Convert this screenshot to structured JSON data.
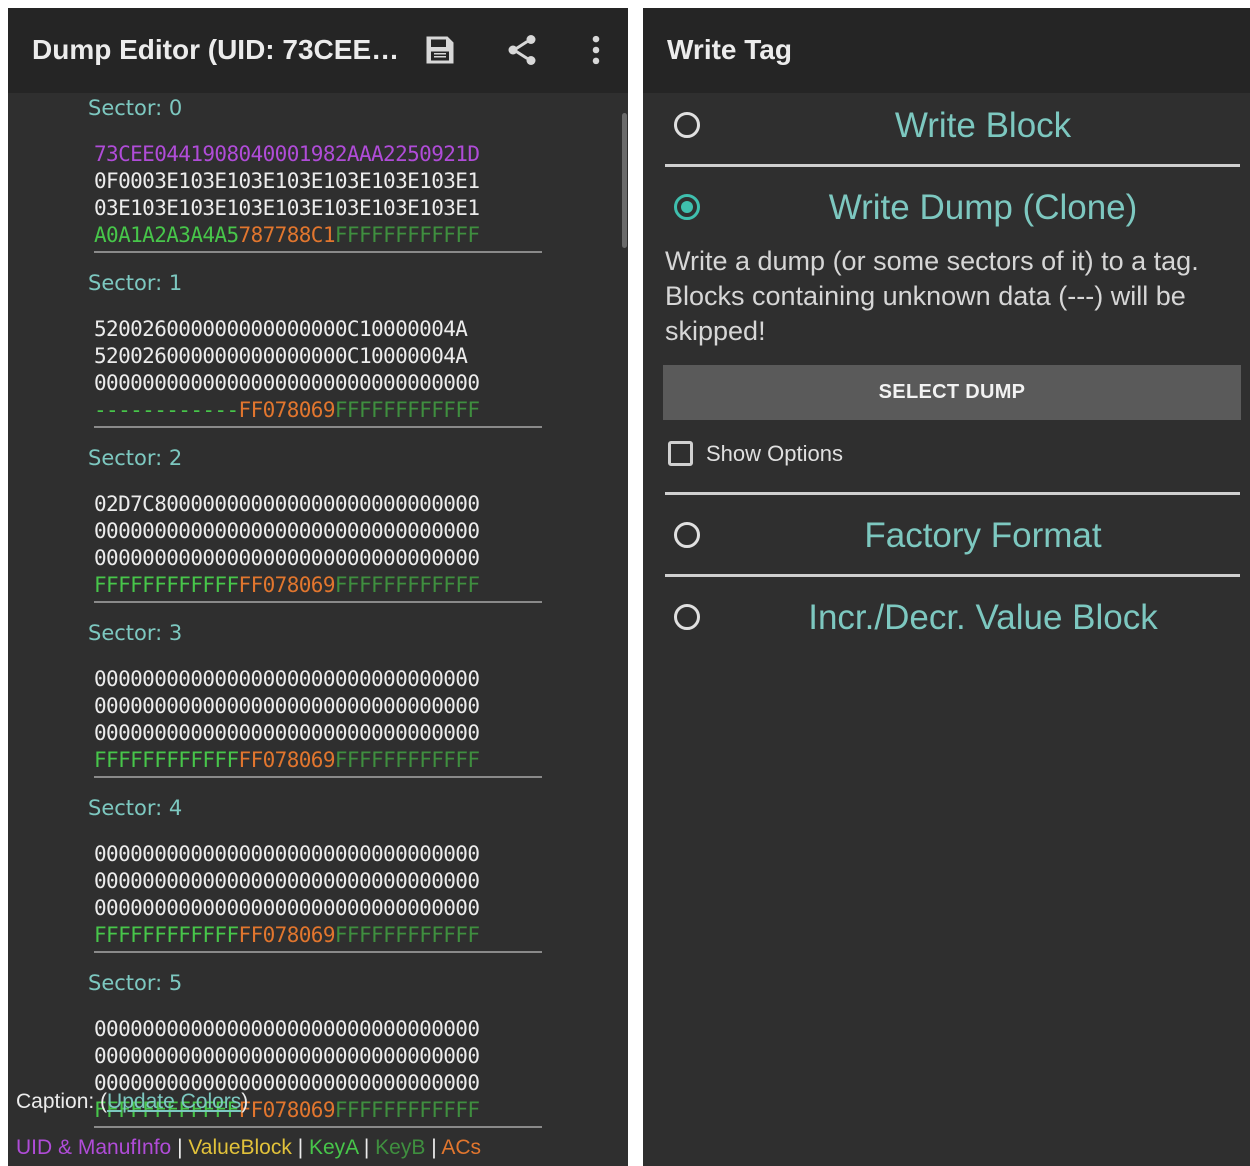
{
  "left_app": {
    "title": "Dump Editor (UID: 73CEE…",
    "icons": [
      "save-icon",
      "share-icon",
      "overflow-menu-icon"
    ],
    "sectors": [
      {
        "label": "Sector: 0",
        "lines": [
          [
            {
              "t": "73CEE0441908040001982AAA2250921D",
              "c": "uid"
            }
          ],
          [
            {
              "t": "0F0003E103E103E103E103E103E103E1",
              "c": "plain"
            }
          ],
          [
            {
              "t": "03E103E103E103E103E103E103E103E1",
              "c": "plain"
            }
          ],
          [
            {
              "t": "A0A1A2A3A4A5",
              "c": "key"
            },
            {
              "t": "787788C1",
              "c": "ac"
            },
            {
              "t": "FFFFFFFFFFFF",
              "c": "keyb"
            }
          ]
        ]
      },
      {
        "label": "Sector: 1",
        "lines": [
          [
            {
              "t": "520026000000000000000C10000004A",
              "c": "plain"
            }
          ],
          [
            {
              "t": "520026000000000000000C10000004A",
              "c": "plain"
            }
          ],
          [
            {
              "t": "00000000000000000000000000000000",
              "c": "plain"
            }
          ],
          [
            {
              "t": "------------",
              "c": "key"
            },
            {
              "t": "FF078069",
              "c": "ac"
            },
            {
              "t": "FFFFFFFFFFFF",
              "c": "keyb"
            }
          ]
        ]
      },
      {
        "label": "Sector: 2",
        "lines": [
          [
            {
              "t": "02D7C800000000000000000000000000",
              "c": "plain"
            }
          ],
          [
            {
              "t": "00000000000000000000000000000000",
              "c": "plain"
            }
          ],
          [
            {
              "t": "00000000000000000000000000000000",
              "c": "plain"
            }
          ],
          [
            {
              "t": "FFFFFFFFFFFF",
              "c": "key"
            },
            {
              "t": "FF078069",
              "c": "ac"
            },
            {
              "t": "FFFFFFFFFFFF",
              "c": "keyb"
            }
          ]
        ]
      },
      {
        "label": "Sector: 3",
        "lines": [
          [
            {
              "t": "00000000000000000000000000000000",
              "c": "plain"
            }
          ],
          [
            {
              "t": "00000000000000000000000000000000",
              "c": "plain"
            }
          ],
          [
            {
              "t": "00000000000000000000000000000000",
              "c": "plain"
            }
          ],
          [
            {
              "t": "FFFFFFFFFFFF",
              "c": "key"
            },
            {
              "t": "FF078069",
              "c": "ac"
            },
            {
              "t": "FFFFFFFFFFFF",
              "c": "keyb"
            }
          ]
        ]
      },
      {
        "label": "Sector: 4",
        "lines": [
          [
            {
              "t": "00000000000000000000000000000000",
              "c": "plain"
            }
          ],
          [
            {
              "t": "00000000000000000000000000000000",
              "c": "plain"
            }
          ],
          [
            {
              "t": "00000000000000000000000000000000",
              "c": "plain"
            }
          ],
          [
            {
              "t": "FFFFFFFFFFFF",
              "c": "key"
            },
            {
              "t": "FF078069",
              "c": "ac"
            },
            {
              "t": "FFFFFFFFFFFF",
              "c": "keyb"
            }
          ]
        ]
      },
      {
        "label": "Sector: 5",
        "lines": [
          [
            {
              "t": "00000000000000000000000000000000",
              "c": "plain"
            }
          ],
          [
            {
              "t": "00000000000000000000000000000000",
              "c": "plain"
            }
          ],
          [
            {
              "t": "00000000000000000000000000000000",
              "c": "plain"
            }
          ],
          [
            {
              "t": "FFFFFFFFFFFF",
              "c": "key"
            },
            {
              "t": "FF078069",
              "c": "ac"
            },
            {
              "t": "FFFFFFFFFFFF",
              "c": "keyb"
            }
          ]
        ]
      }
    ],
    "caption": {
      "prefix": "Caption: (",
      "link": "Update Colors",
      "suffix": ")"
    },
    "legend": [
      {
        "t": "UID & ManufInfo",
        "c": "uid"
      },
      {
        "t": "ValueBlock",
        "c": "val"
      },
      {
        "t": "KeyA",
        "c": "key"
      },
      {
        "t": "KeyB",
        "c": "keyb"
      },
      {
        "t": "ACs",
        "c": "ac"
      }
    ],
    "legend_separator": " | "
  },
  "right_app": {
    "title": "Write Tag",
    "options": {
      "write_block": {
        "label": "Write Block",
        "selected": false
      },
      "write_dump": {
        "label": "Write Dump (Clone)",
        "selected": true
      },
      "factory_format": {
        "label": "Factory Format",
        "selected": false
      },
      "value_block": {
        "label": "Incr./Decr. Value Block",
        "selected": false
      }
    },
    "description": "Write a dump (or some sectors of it) to a tag. Blocks containing unknown data (---) will be skipped!",
    "select_dump_label": "SELECT DUMP",
    "show_options": {
      "label": "Show Options",
      "checked": false
    }
  },
  "colors": {
    "accent": "#3fbfae",
    "uid": "#b04cd8",
    "key_a": "#47c64a",
    "key_b": "#3f8f3f",
    "access_conditions": "#e2762e",
    "value_block": "#e2c23a",
    "panel_bg": "#2f2f2f",
    "toolbar_bg": "#252525"
  }
}
